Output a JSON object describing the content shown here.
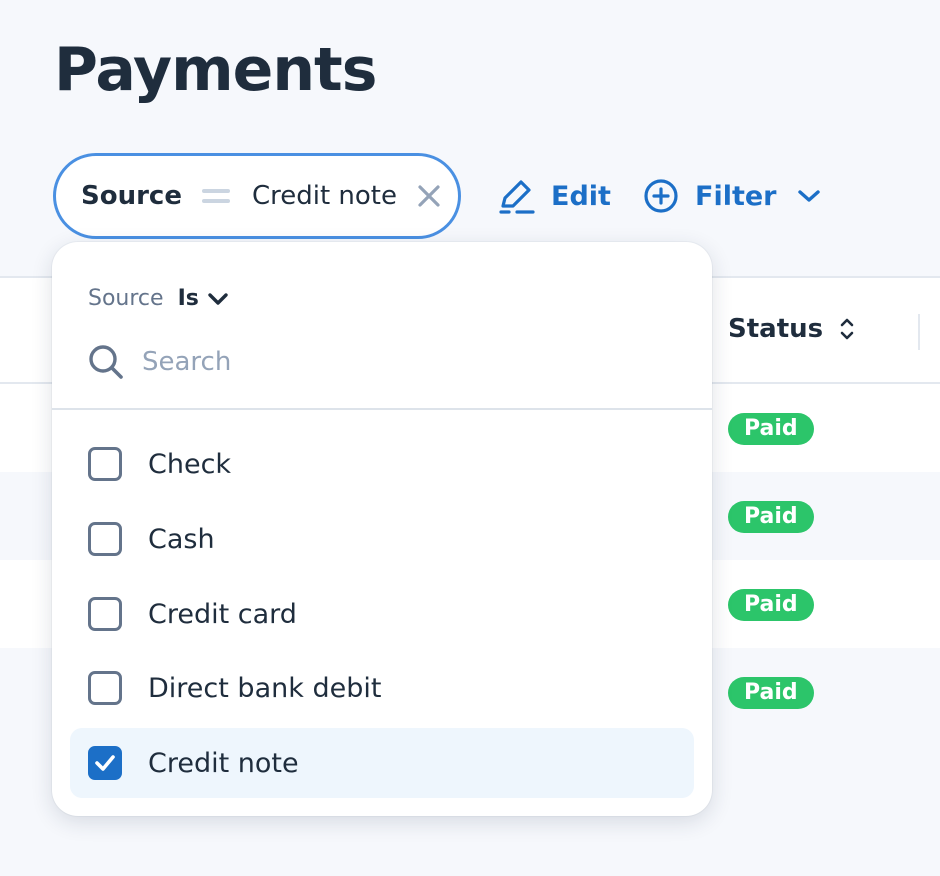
{
  "page": {
    "title": "Payments"
  },
  "filter_chip": {
    "field": "Source",
    "value": "Credit note"
  },
  "toolbar": {
    "edit_label": "Edit",
    "filter_label": "Filter"
  },
  "table": {
    "status_header": "Status",
    "rows": [
      {
        "status": "Paid"
      },
      {
        "status": "Paid"
      },
      {
        "status": "Paid"
      },
      {
        "status": "Paid"
      }
    ]
  },
  "dropdown": {
    "field_label": "Source",
    "operator": "Is",
    "search_placeholder": "Search",
    "options": [
      {
        "label": "Check",
        "checked": false
      },
      {
        "label": "Cash",
        "checked": false
      },
      {
        "label": "Credit card",
        "checked": false
      },
      {
        "label": "Direct bank debit",
        "checked": false
      },
      {
        "label": "Credit note",
        "checked": true
      }
    ]
  },
  "colors": {
    "accent": "#1c6fc7",
    "chip_border": "#4a90e2",
    "paid_badge": "#2cc56a",
    "background": "#f6f8fc"
  },
  "icons": {
    "chip_close": "x-icon",
    "edit": "pencil-icon",
    "filter": "plus-circle-icon",
    "filter_menu": "chevron-down-icon",
    "sort": "sort-icon",
    "operator": "chevron-down-icon",
    "search": "search-icon",
    "checked": "checkmark-icon"
  }
}
